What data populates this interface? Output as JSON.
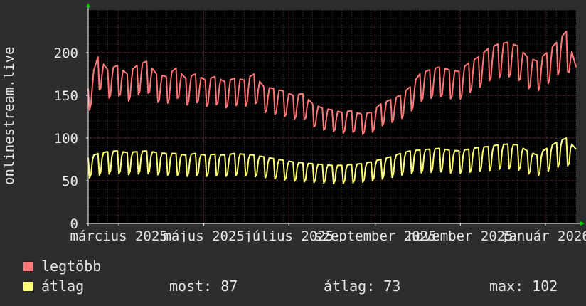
{
  "chart_data": {
    "type": "line",
    "ylabel": "onlinestream.live",
    "ylim": [
      0,
      250
    ],
    "yticks": [
      0,
      50,
      100,
      150,
      200
    ],
    "xlim": [
      "2025-02-07",
      "2026-01-23"
    ],
    "xticks": [
      {
        "label": "március 2025",
        "date": "2025-03-01"
      },
      {
        "label": "május 2025",
        "date": "2025-05-01"
      },
      {
        "label": "július 2025",
        "date": "2025-07-01"
      },
      {
        "label": "szeptember 2025",
        "date": "2025-09-01"
      },
      {
        "label": "november 2025",
        "date": "2025-11-01"
      },
      {
        "label": "január 2026",
        "date": "2026-01-01"
      }
    ],
    "grid": true,
    "legend_position": "bottom-left",
    "series": [
      {
        "name": "legtöbb",
        "color": "#ff7777",
        "points": [
          [
            "2025-02-07",
            158
          ],
          [
            "2025-02-14",
            195
          ],
          [
            "2025-02-21",
            180
          ],
          [
            "2025-02-28",
            185
          ],
          [
            "2025-03-07",
            175
          ],
          [
            "2025-03-14",
            185
          ],
          [
            "2025-03-21",
            190
          ],
          [
            "2025-03-28",
            175
          ],
          [
            "2025-04-04",
            172
          ],
          [
            "2025-04-11",
            182
          ],
          [
            "2025-04-18",
            170
          ],
          [
            "2025-04-25",
            175
          ],
          [
            "2025-05-02",
            168
          ],
          [
            "2025-05-09",
            172
          ],
          [
            "2025-05-16",
            166
          ],
          [
            "2025-05-23",
            170
          ],
          [
            "2025-05-30",
            168
          ],
          [
            "2025-06-06",
            175
          ],
          [
            "2025-06-13",
            160
          ],
          [
            "2025-06-20",
            158
          ],
          [
            "2025-06-27",
            155
          ],
          [
            "2025-07-04",
            150
          ],
          [
            "2025-07-11",
            152
          ],
          [
            "2025-07-18",
            140
          ],
          [
            "2025-07-25",
            135
          ],
          [
            "2025-08-01",
            133
          ],
          [
            "2025-08-08",
            130
          ],
          [
            "2025-08-15",
            132
          ],
          [
            "2025-08-22",
            128
          ],
          [
            "2025-08-29",
            130
          ],
          [
            "2025-09-05",
            140
          ],
          [
            "2025-09-12",
            145
          ],
          [
            "2025-09-19",
            150
          ],
          [
            "2025-09-26",
            160
          ],
          [
            "2025-10-03",
            175
          ],
          [
            "2025-10-10",
            180
          ],
          [
            "2025-10-17",
            183
          ],
          [
            "2025-10-24",
            180
          ],
          [
            "2025-10-31",
            178
          ],
          [
            "2025-11-07",
            188
          ],
          [
            "2025-11-14",
            195
          ],
          [
            "2025-11-21",
            205
          ],
          [
            "2025-11-28",
            210
          ],
          [
            "2025-12-05",
            212
          ],
          [
            "2025-12-12",
            208
          ],
          [
            "2025-12-19",
            195
          ],
          [
            "2025-12-26",
            190
          ],
          [
            "2026-01-02",
            200
          ],
          [
            "2026-01-09",
            212
          ],
          [
            "2026-01-16",
            225
          ],
          [
            "2026-01-23",
            183
          ]
        ],
        "weekly_low": 105
      },
      {
        "name": "átlag",
        "color": "#ffff77",
        "points": [
          [
            "2025-02-07",
            77
          ],
          [
            "2025-02-14",
            82
          ],
          [
            "2025-02-21",
            84
          ],
          [
            "2025-02-28",
            85
          ],
          [
            "2025-03-07",
            83
          ],
          [
            "2025-03-14",
            84
          ],
          [
            "2025-03-21",
            85
          ],
          [
            "2025-03-28",
            83
          ],
          [
            "2025-04-04",
            82
          ],
          [
            "2025-04-11",
            82
          ],
          [
            "2025-04-18",
            80
          ],
          [
            "2025-04-25",
            82
          ],
          [
            "2025-05-02",
            80
          ],
          [
            "2025-05-09",
            81
          ],
          [
            "2025-05-16",
            80
          ],
          [
            "2025-05-23",
            82
          ],
          [
            "2025-05-30",
            81
          ],
          [
            "2025-06-06",
            80
          ],
          [
            "2025-06-13",
            78
          ],
          [
            "2025-06-20",
            76
          ],
          [
            "2025-06-27",
            74
          ],
          [
            "2025-07-04",
            72
          ],
          [
            "2025-07-11",
            71
          ],
          [
            "2025-07-18",
            70
          ],
          [
            "2025-07-25",
            69
          ],
          [
            "2025-08-01",
            68
          ],
          [
            "2025-08-08",
            68
          ],
          [
            "2025-08-15",
            69
          ],
          [
            "2025-08-22",
            70
          ],
          [
            "2025-08-29",
            72
          ],
          [
            "2025-09-05",
            75
          ],
          [
            "2025-09-12",
            78
          ],
          [
            "2025-09-19",
            82
          ],
          [
            "2025-09-26",
            85
          ],
          [
            "2025-10-03",
            86
          ],
          [
            "2025-10-10",
            87
          ],
          [
            "2025-10-17",
            88
          ],
          [
            "2025-10-24",
            86
          ],
          [
            "2025-10-31",
            85
          ],
          [
            "2025-11-07",
            87
          ],
          [
            "2025-11-14",
            89
          ],
          [
            "2025-11-21",
            90
          ],
          [
            "2025-11-28",
            92
          ],
          [
            "2025-12-05",
            93
          ],
          [
            "2025-12-12",
            92
          ],
          [
            "2025-12-19",
            85
          ],
          [
            "2025-12-26",
            80
          ],
          [
            "2026-01-02",
            88
          ],
          [
            "2026-01-09",
            95
          ],
          [
            "2026-01-16",
            100
          ],
          [
            "2026-01-23",
            87
          ]
        ],
        "weekly_low": 55
      }
    ]
  },
  "legend": [
    {
      "label": "legtöbb",
      "color": "#ff7777"
    },
    {
      "label": "átlag",
      "color": "#ffff77"
    }
  ],
  "stats": {
    "most": "most: 87",
    "atlag": "átlag: 73",
    "max": "max: 102"
  },
  "colors": {
    "background": "#2d2d2d",
    "plot_background": "#000000",
    "grid_minor": "#3a3a3a",
    "grid_major": "#6b3030",
    "axis": "#ffffff",
    "arrow": "#00cc00"
  }
}
